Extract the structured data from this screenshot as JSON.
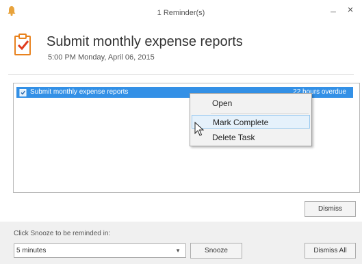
{
  "window": {
    "title": "1 Reminder(s)",
    "minimize_glyph": "–",
    "close_glyph": "×"
  },
  "header": {
    "subject": "Submit monthly expense reports",
    "due": "5:00 PM Monday, April 06, 2015"
  },
  "reminders": [
    {
      "subject": "Submit monthly expense reports",
      "due_in": "22 hours overdue",
      "icon": "task-icon"
    }
  ],
  "context_menu": {
    "items": [
      {
        "label": "Open"
      },
      {
        "label": "Mark Complete",
        "highlighted": true
      },
      {
        "label": "Delete Task"
      }
    ]
  },
  "buttons": {
    "dismiss": "Dismiss",
    "snooze": "Snooze",
    "dismiss_all": "Dismiss All"
  },
  "snooze": {
    "label": "Click Snooze to be reminded in:",
    "selected": "5 minutes"
  },
  "colors": {
    "selection": "#3390e6",
    "task_icon_orange": "#e8821e",
    "bell": "#e8a33c"
  }
}
